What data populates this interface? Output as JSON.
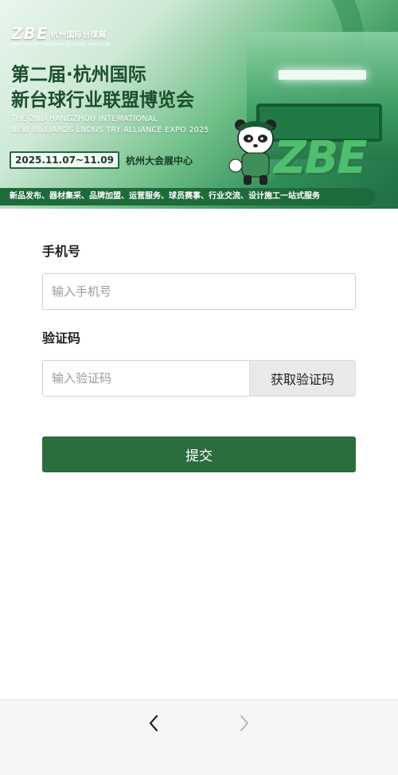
{
  "banner": {
    "logo": "ZBE",
    "logo_sub": "杭州国际台球展",
    "logo_tiny": "HANGZHOU INTERNATIONAL BILLIARDS EXHIBITION",
    "title_line1": "第二届·杭州国际",
    "title_line2": "新台球行业联盟博览会",
    "en_line1": "THE 2ND HANGZHOU INTEMATIONAL",
    "en_line2": "NEW BILLIARDS LNDUS TRY ALLIANCE EXPO 2025",
    "date": "2025.11.07~11.09",
    "venue": "杭州大会展中心",
    "big_logo": "ZBE",
    "services": "新品发布、器材集采、品牌加盟、运营服务、球员赛事、行业交流、设计施工一站式服务"
  },
  "form": {
    "phone_label": "手机号",
    "phone_placeholder": "输入手机号",
    "code_label": "验证码",
    "code_placeholder": "输入验证码",
    "get_code_label": "获取验证码",
    "submit_label": "提交"
  },
  "nav": {
    "back_icon": "chevron-left-icon",
    "forward_icon": "chevron-right-icon"
  },
  "colors": {
    "brand_green": "#2b6d3d",
    "banner_dark_green": "#1d6b3a",
    "code_button_bg": "#e9e9e9"
  }
}
